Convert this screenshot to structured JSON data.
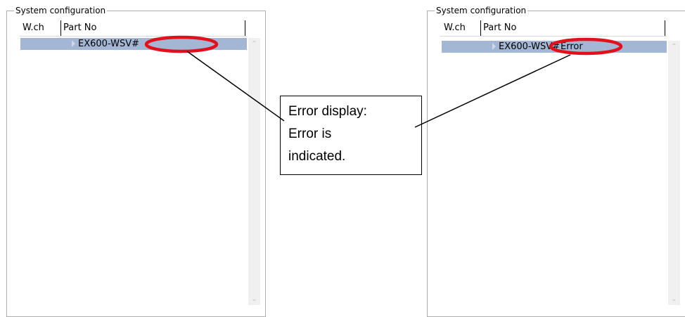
{
  "left_panel": {
    "group_title": "System configuration",
    "columns": [
      "W.ch",
      "Part No"
    ],
    "row": {
      "part_no": "EX600-WSV#",
      "status": ""
    }
  },
  "right_panel": {
    "group_title": "System configuration",
    "columns": [
      "W.ch",
      "Part No"
    ],
    "row": {
      "part_no": "EX600-WSV#",
      "status": "Error"
    }
  },
  "callout": {
    "lines": [
      "Error display:",
      "Error is",
      "indicated."
    ]
  },
  "colors": {
    "highlight_ellipse": "#e2101b",
    "selected_row": "#a3b7d4",
    "scrollbar_track": "#f0f0f0"
  },
  "icons": [
    "scroll-up-arrow-icon",
    "scroll-down-arrow-icon",
    "row-expand-icon"
  ]
}
